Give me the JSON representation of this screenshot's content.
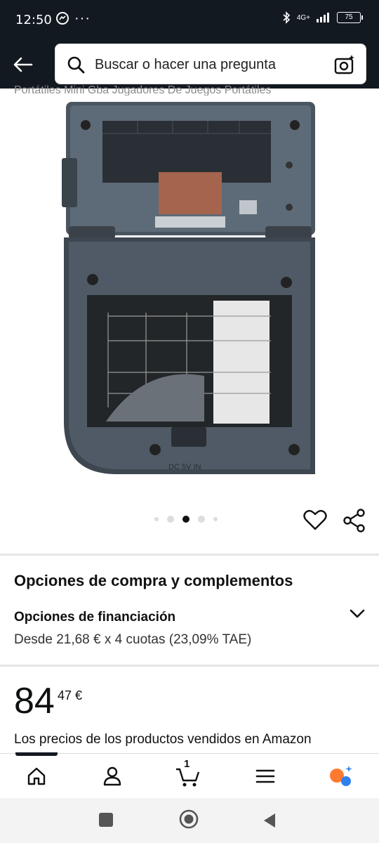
{
  "status_bar": {
    "time": "12:50",
    "network": "4G+",
    "battery": "75"
  },
  "search": {
    "placeholder": "Buscar o hacer una pregunta"
  },
  "product": {
    "title_clipped": "Portátiles Mini Gba Jugadores De Juegos Portátiles"
  },
  "carousel": {
    "total": 5,
    "active": 2
  },
  "purchase_options": {
    "title": "Opciones de compra y complementos",
    "financing_title": "Opciones de financiación",
    "financing_desc": "Desde 21,68 € x 4 cuotas (23,09% TAE)"
  },
  "price": {
    "whole": "84",
    "fraction": "47 €",
    "note": "Los precios de los productos vendidos en Amazon"
  },
  "bottom_nav": {
    "cart_count": "1"
  },
  "colors": {
    "header_bg": "#131921",
    "accent_orange": "#ff7a30",
    "accent_blue": "#2f80ed"
  }
}
